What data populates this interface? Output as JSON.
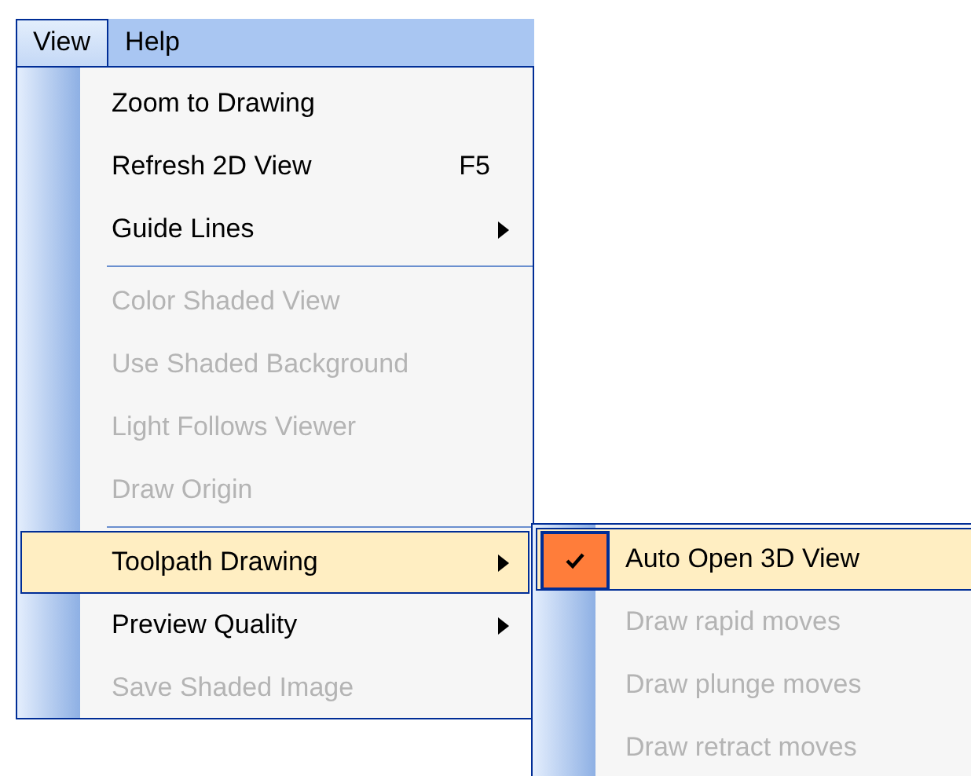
{
  "menubar": [
    {
      "label": "View",
      "selected": true
    },
    {
      "label": "Help",
      "selected": false
    }
  ],
  "menu": {
    "items": [
      {
        "kind": "item",
        "label": "Zoom to Drawing",
        "disabled": false,
        "selected": false
      },
      {
        "kind": "item",
        "label": "Refresh 2D View",
        "shortcut": "F5",
        "disabled": false,
        "selected": false
      },
      {
        "kind": "item",
        "label": "Guide Lines",
        "submenu": true,
        "disabled": false,
        "selected": false
      },
      {
        "kind": "separator"
      },
      {
        "kind": "item",
        "label": "Color Shaded View",
        "disabled": true,
        "selected": false
      },
      {
        "kind": "item",
        "label": "Use Shaded Background",
        "disabled": true,
        "selected": false
      },
      {
        "kind": "item",
        "label": "Light Follows Viewer",
        "disabled": true,
        "selected": false
      },
      {
        "kind": "item",
        "label": "Draw Origin",
        "disabled": true,
        "selected": false
      },
      {
        "kind": "separator"
      },
      {
        "kind": "item",
        "label": "Toolpath Drawing",
        "submenu": true,
        "disabled": false,
        "selected": true
      },
      {
        "kind": "item",
        "label": "Preview Quality",
        "submenu": true,
        "disabled": false,
        "selected": false
      },
      {
        "kind": "item",
        "label": "Save Shaded Image",
        "disabled": true,
        "selected": false
      }
    ]
  },
  "submenu": {
    "items": [
      {
        "kind": "item",
        "label": "Auto Open 3D View",
        "checked": true,
        "disabled": false,
        "selected": true
      },
      {
        "kind": "item",
        "label": "Draw rapid moves",
        "checked": false,
        "disabled": true,
        "selected": false
      },
      {
        "kind": "item",
        "label": "Draw plunge moves",
        "checked": false,
        "disabled": true,
        "selected": false
      },
      {
        "kind": "item",
        "label": "Draw retract moves",
        "checked": false,
        "disabled": true,
        "selected": false
      }
    ]
  }
}
